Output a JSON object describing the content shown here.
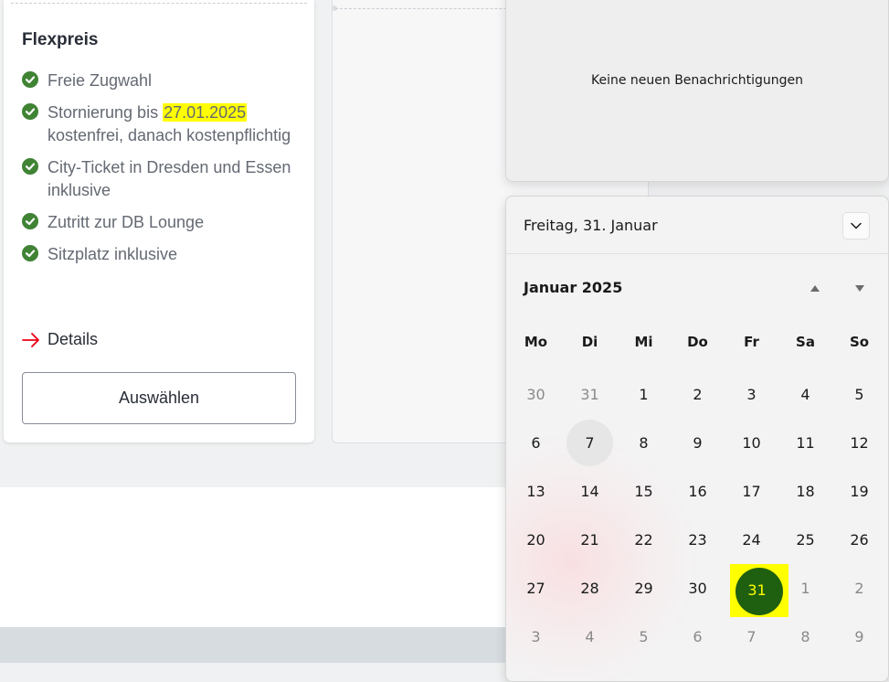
{
  "fare": {
    "title": "Flexpreis",
    "features": [
      {
        "text": "Freie Zugwahl"
      },
      {
        "before": "Stornierung bis ",
        "highlight": "27.01.2025",
        "after": "kostenfrei, danach kostenpflichtig"
      },
      {
        "text": "City-Ticket in Dresden und Essen inklusive"
      },
      {
        "text": "Zutritt zur DB Lounge"
      },
      {
        "text": "Sitzplatz inklusive"
      }
    ],
    "details_label": "Details",
    "select_label": "Auswählen"
  },
  "notifications": {
    "empty_text": "Keine neuen Benachrichtigungen"
  },
  "calendar": {
    "date_label": "Freitag, 31. Januar",
    "month_label": "Januar 2025",
    "weekdays": [
      "Mo",
      "Di",
      "Mi",
      "Do",
      "Fr",
      "Sa",
      "So"
    ],
    "days": [
      "30",
      "31",
      "1",
      "2",
      "3",
      "4",
      "5",
      "6",
      "7",
      "8",
      "9",
      "10",
      "11",
      "12",
      "13",
      "14",
      "15",
      "16",
      "17",
      "18",
      "19",
      "20",
      "21",
      "22",
      "23",
      "24",
      "25",
      "26",
      "27",
      "28",
      "29",
      "30",
      "31",
      "1",
      "2",
      "3",
      "4",
      "5",
      "6",
      "7",
      "8",
      "9"
    ],
    "today": "7",
    "selected": "31"
  },
  "colors": {
    "check_green": "#408335",
    "highlight_yellow": "#ffff00",
    "selected_day_green": "#1f5f10",
    "db_red": "#ec0016"
  }
}
